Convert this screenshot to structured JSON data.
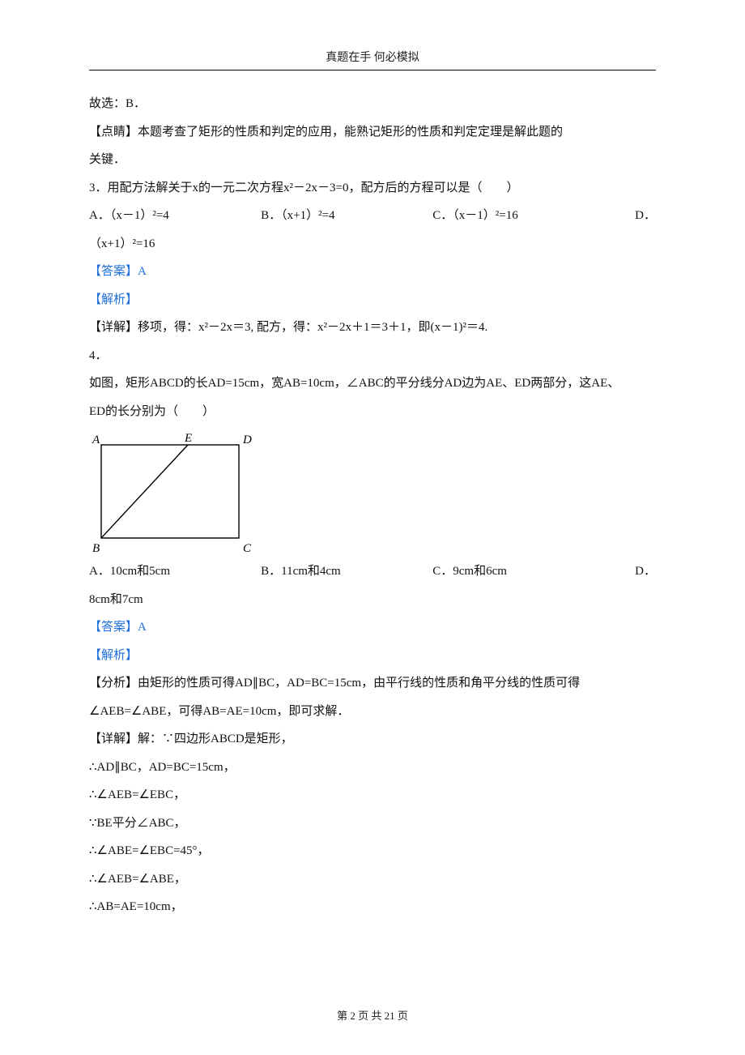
{
  "header": "真题在手 何必模拟",
  "body": {
    "q2_tail": {
      "l1": "故选：B．",
      "l2": "【点睛】本题考查了矩形的性质和判定的应用，能熟记矩形的性质和判定定理是解此题的",
      "l3": "关键．"
    },
    "q3": {
      "stem": "3．用配方法解关于x的一元二次方程x²－2x－3=0，配方后的方程可以是（　　）",
      "opts": {
        "a": "A．（x－1）²=4",
        "b": "B．（x+1）²=4",
        "c": "C．（x－1）²=16",
        "d": "D．"
      },
      "d_text": "（x+1）²=16",
      "answer_label": "【答案】",
      "answer": "A",
      "analysis_label": "【解析】",
      "detail": "【详解】移项，得：x²－2x＝3,  配方，得：x²－2x＋1＝3＋1，即(x－1)²＝4."
    },
    "q4": {
      "num": "4．",
      "stem1": "如图，矩形ABCD的长AD=15cm，宽AB=10cm，∠ABC的平分线分AD边为AE、ED两部分，这AE、",
      "stem2": "ED的长分别为（　　）",
      "figure_labels": {
        "A": "A",
        "E": "E",
        "D": "D",
        "B": "B",
        "C": "C"
      },
      "opts": {
        "a": "A．10cm和5cm",
        "b": "B．11cm和4cm",
        "c": "C．9cm和6cm",
        "d": "D．"
      },
      "d_text": "8cm和7cm",
      "answer_label": "【答案】",
      "answer": "A",
      "analysis_label": "【解析】",
      "analyze1": "【分析】由矩形的性质可得AD∥BC，AD=BC=15cm，由平行线的性质和角平分线的性质可得",
      "analyze2": "∠AEB=∠ABE，可得AB=AE=10cm，即可求解．",
      "detail1": "【详解】解：∵四边形ABCD是矩形，",
      "detail2": "∴AD∥BC，AD=BC=15cm，",
      "detail3": "∴∠AEB=∠EBC，",
      "detail4": "∵BE平分∠ABC，",
      "detail5": "∴∠ABE=∠EBC=45°，",
      "detail6": "∴∠AEB=∠ABE，",
      "detail7": "∴AB=AE=10cm，"
    }
  },
  "footer": {
    "prefix": "第",
    "current": "2",
    "mid": "页 共",
    "total": "21",
    "suffix": "页"
  }
}
